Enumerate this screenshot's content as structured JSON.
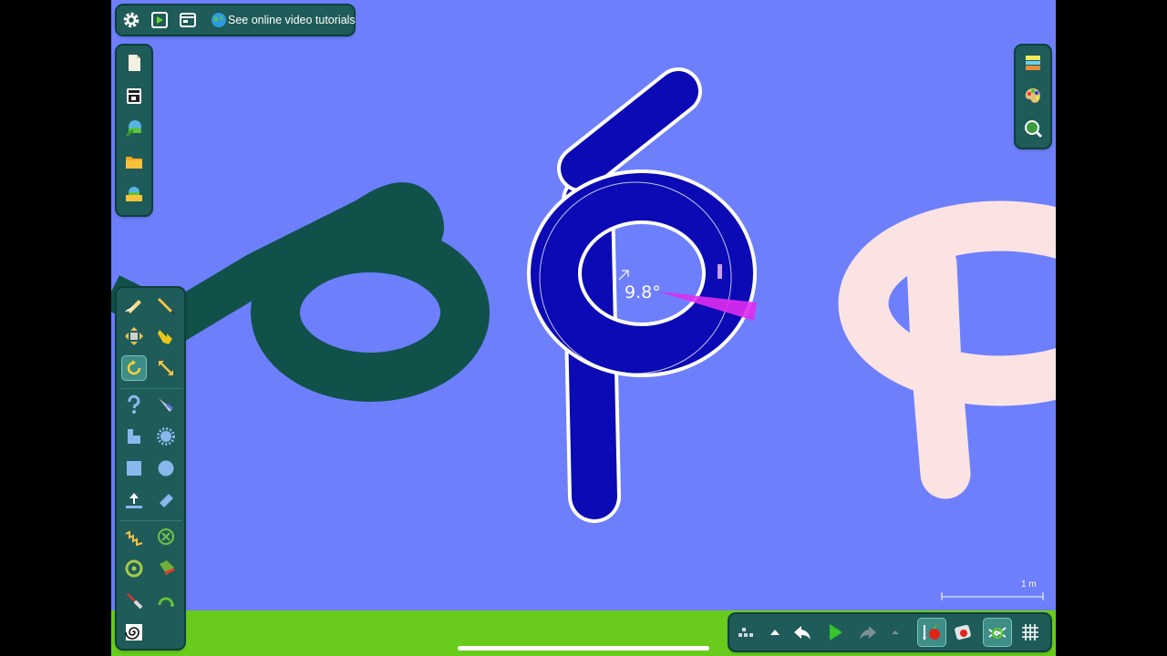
{
  "top_toolbar": {
    "settings_icon": "gear-icon",
    "play_icon": "play-icon",
    "window_icon": "window-icon",
    "tutorials_icon": "globe-icon",
    "tutorials_label": "See online video tutorials"
  },
  "left_file_panel": {
    "items": [
      "new-document-icon",
      "save-scene-icon",
      "load-scenery-icon",
      "open-folder-icon",
      "open-scene-folder-icon"
    ]
  },
  "right_panel": {
    "items": [
      "background-layers-icon",
      "color-palette-icon",
      "zoom-object-icon"
    ]
  },
  "tool_panel": {
    "items": [
      "sketch-tool-icon",
      "draw-pencil-icon",
      "move-tool-icon",
      "drag-hand-icon",
      "rotate-tool-icon",
      "scale-tool-icon",
      "hinge-tool-icon",
      "cut-knife-icon",
      "polygon-tool-icon",
      "gear-shape-icon",
      "box-tool-icon",
      "circle-tool-icon",
      "fixate-tool-icon",
      "roll-tool-icon",
      "spring-tool-icon",
      "remove-tool-icon",
      "axle-tool-icon",
      "attach-tool-icon",
      "laser-tool-icon",
      "tracer-tool-icon",
      "spiral-tool-icon"
    ],
    "selected": "rotate-tool-icon"
  },
  "canvas": {
    "rotation_readout": "9.8°",
    "scale_label": "1 m"
  },
  "bottom_toolbar": {
    "items": [
      "grid-menu-icon",
      "up-arrow-icon",
      "undo-icon",
      "play-simulation-icon",
      "redo-icon",
      "expand-arrow-icon",
      "gravity-apple-icon",
      "air-resistance-icon",
      "controller-icon",
      "grid-toggle-icon"
    ]
  },
  "colors": {
    "sky": "#6e7ffc",
    "ground": "#69cc1c",
    "panel": "#1f5b58",
    "green_shape": "#10524a",
    "blue_shape": "#0b0ab4",
    "pink_shape": "#fbe3e3",
    "rotation_wedge": "#e02cf0"
  }
}
